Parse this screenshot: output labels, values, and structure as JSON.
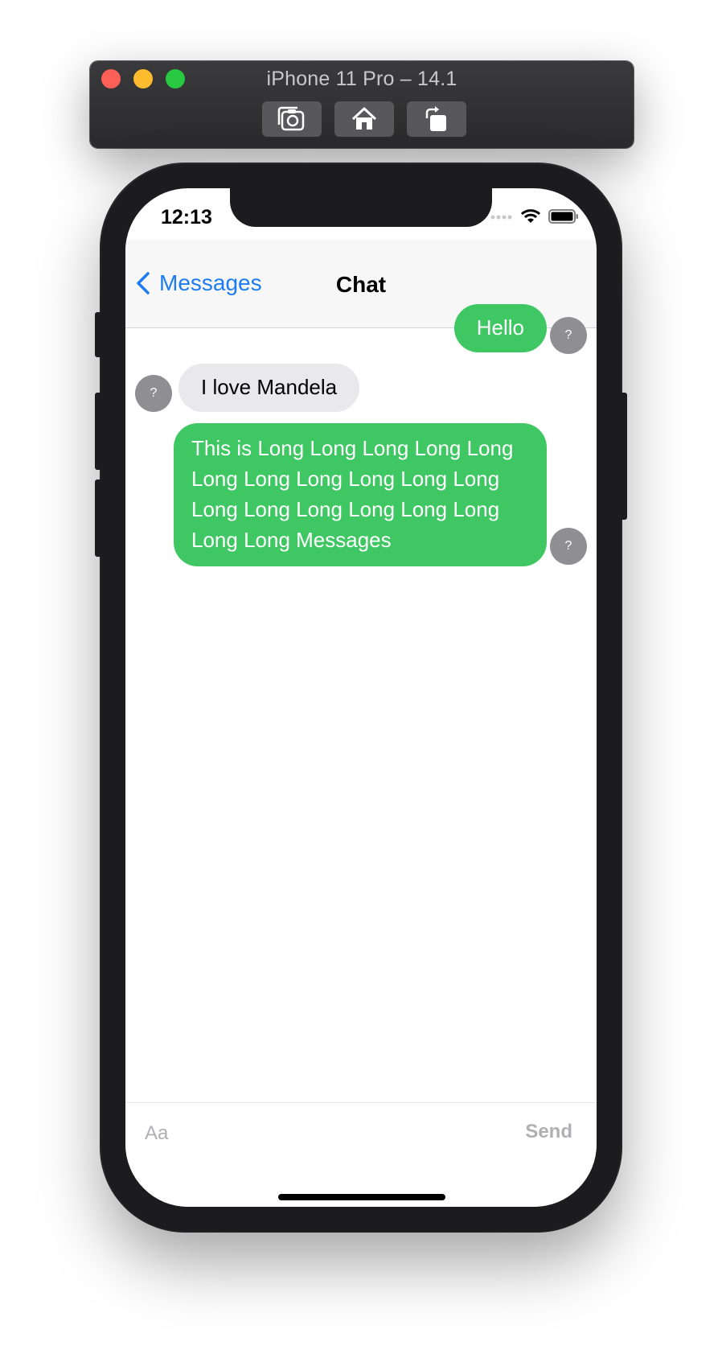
{
  "simulator": {
    "title": "iPhone 11 Pro – 14.1",
    "buttons": [
      "screenshot-icon",
      "home-icon",
      "rotate-icon"
    ]
  },
  "status_bar": {
    "time": "12:13",
    "icons": [
      "signal-icon",
      "wifi-icon",
      "battery-icon"
    ]
  },
  "navbar": {
    "back_label": "Messages",
    "title": "Chat"
  },
  "messages": [
    {
      "direction": "outgoing",
      "text": "Hello",
      "avatar": "?"
    },
    {
      "direction": "incoming",
      "text": "I love Mandela",
      "avatar": "?"
    },
    {
      "direction": "outgoing",
      "text": "This is Long Long Long Long Long Long Long Long Long Long Long Long Long Long Long Long Long Long Long Messages",
      "avatar": "?"
    }
  ],
  "composer": {
    "placeholder": "Aa",
    "value": "",
    "send_label": "Send"
  },
  "colors": {
    "outgoing_bubble": "#3ec762",
    "incoming_bubble": "#e8e8ed",
    "link_blue": "#1e7cf2",
    "avatar_gray": "#8e8e93"
  }
}
